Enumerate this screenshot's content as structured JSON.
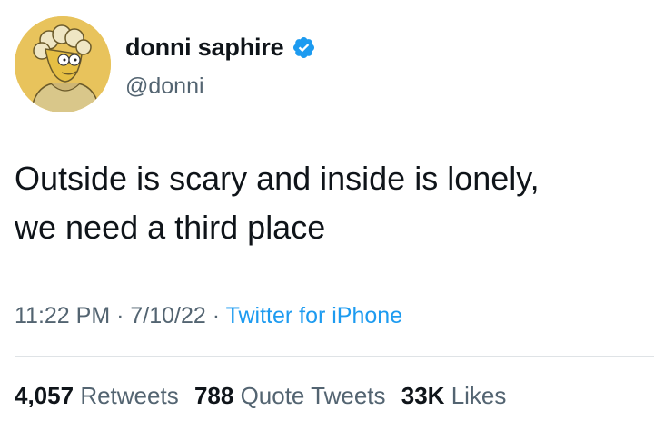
{
  "user": {
    "display_name": "donni saphire",
    "handle": "@donni",
    "verified_icon": "verified-badge-icon",
    "avatar_icon": "cartoon-avatar"
  },
  "tweet": {
    "text": "Outside is scary and inside is lonely,\nwe need a third place",
    "time": "11:22 PM",
    "separator_1": " · ",
    "date": "7/10/22",
    "separator_2": " · ",
    "source": "Twitter for iPhone"
  },
  "stats": {
    "retweets_count": "4,057",
    "retweets_label": "Retweets",
    "quote_tweets_count": "788",
    "quote_tweets_label": "Quote Tweets",
    "likes_count": "33K",
    "likes_label": "Likes"
  },
  "colors": {
    "link_blue": "#1d9bf0",
    "secondary_text": "#536471",
    "primary_text": "#0f1419"
  }
}
